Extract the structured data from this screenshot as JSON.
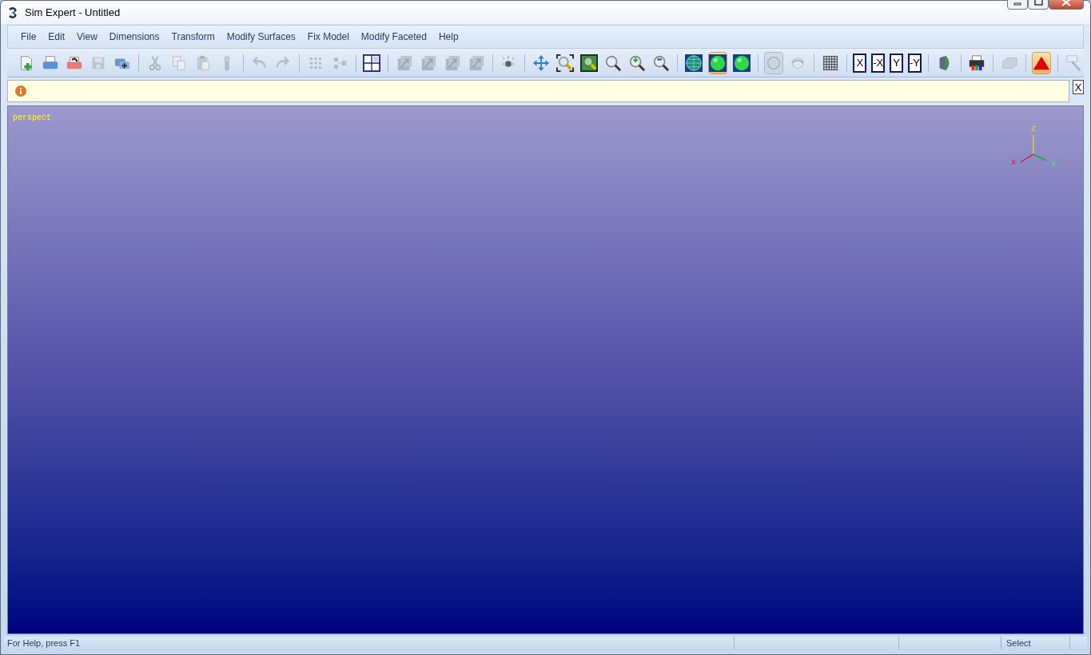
{
  "window": {
    "title": "Sim Expert - Untitled"
  },
  "menu": [
    "File",
    "Edit",
    "View",
    "Dimensions",
    "Transform",
    "Modify Surfaces",
    "Fix Model",
    "Modify Faceted",
    "Help"
  ],
  "toolbar": [
    [
      {
        "kind": "new",
        "disabled": false,
        "selected": false
      },
      {
        "kind": "print",
        "disabled": false,
        "selected": false
      },
      {
        "kind": "open",
        "disabled": false,
        "selected": false
      },
      {
        "kind": "save",
        "disabled": true,
        "selected": false
      },
      {
        "kind": "export",
        "disabled": false,
        "selected": false
      }
    ],
    [
      {
        "kind": "cut",
        "disabled": true,
        "selected": false
      },
      {
        "kind": "copy",
        "disabled": true,
        "selected": false
      },
      {
        "kind": "paste",
        "disabled": true,
        "selected": false
      },
      {
        "kind": "tool",
        "disabled": true,
        "selected": false
      }
    ],
    [
      {
        "kind": "undo",
        "disabled": true,
        "selected": false
      },
      {
        "kind": "redo",
        "disabled": true,
        "selected": false
      }
    ],
    [
      {
        "kind": "grid-dots",
        "disabled": true,
        "selected": false
      },
      {
        "kind": "nodes",
        "disabled": true,
        "selected": false
      }
    ],
    [
      {
        "kind": "views",
        "disabled": false,
        "selected": false
      }
    ],
    [
      {
        "kind": "arrow",
        "disabled": true,
        "selected": false
      },
      {
        "kind": "arrow",
        "disabled": true,
        "selected": false
      },
      {
        "kind": "arrow",
        "disabled": true,
        "selected": false
      },
      {
        "kind": "arrow",
        "disabled": true,
        "selected": false
      }
    ],
    [
      {
        "kind": "eye",
        "disabled": false,
        "selected": false
      }
    ],
    [
      {
        "kind": "pan",
        "disabled": false,
        "selected": false
      },
      {
        "kind": "zoom-box",
        "disabled": false,
        "selected": false
      },
      {
        "kind": "zoom-fit",
        "disabled": false,
        "selected": false
      },
      {
        "kind": "zoom",
        "disabled": false,
        "selected": false
      },
      {
        "kind": "zoom-in",
        "disabled": false,
        "selected": false
      },
      {
        "kind": "zoom-out",
        "disabled": false,
        "selected": false
      }
    ],
    [
      {
        "kind": "sphere-wire",
        "disabled": false,
        "selected": false
      },
      {
        "kind": "sphere",
        "disabled": false,
        "selected": true
      },
      {
        "kind": "sphere",
        "disabled": false,
        "selected": false
      }
    ],
    [
      {
        "kind": "circle",
        "disabled": true,
        "selected": true
      },
      {
        "kind": "rotate",
        "disabled": true,
        "selected": false
      }
    ],
    [
      {
        "kind": "mesh",
        "disabled": false,
        "selected": false
      }
    ],
    [
      {
        "kind": "text",
        "label": "X",
        "disabled": false,
        "selected": false
      },
      {
        "kind": "text",
        "label": "-X",
        "disabled": false,
        "selected": false
      },
      {
        "kind": "text",
        "label": "Y",
        "disabled": false,
        "selected": false
      },
      {
        "kind": "text",
        "label": "-Y",
        "disabled": false,
        "selected": false
      }
    ],
    [
      {
        "kind": "solid",
        "disabled": false,
        "selected": false
      }
    ],
    [
      {
        "kind": "printer",
        "disabled": false,
        "selected": false
      }
    ],
    [
      {
        "kind": "block",
        "disabled": true,
        "selected": false
      }
    ],
    [
      {
        "kind": "triangle",
        "disabled": false,
        "selected": true
      }
    ],
    [
      {
        "kind": "probe",
        "disabled": true,
        "selected": false
      }
    ]
  ],
  "info_bar": {
    "close": "X"
  },
  "viewport": {
    "view_name": "perspect",
    "axes": {
      "z": "Z",
      "x": "X",
      "y": "Y"
    }
  },
  "status_bar": {
    "help": "For Help, press F1",
    "mode": "Select"
  }
}
